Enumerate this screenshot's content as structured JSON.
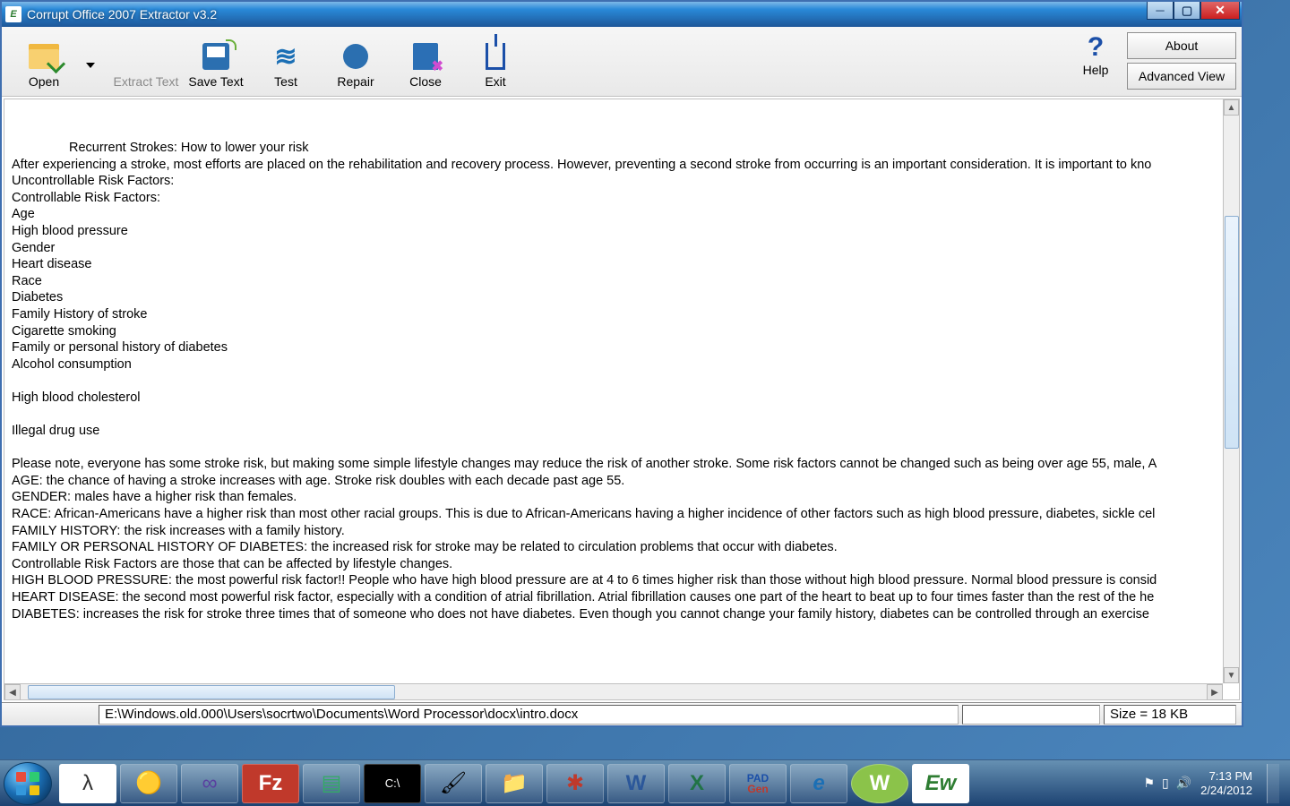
{
  "window": {
    "title": "Corrupt Office 2007 Extractor v3.2"
  },
  "toolbar": {
    "open": "Open",
    "extract_text": "Extract Text",
    "save_text": "Save Text",
    "test": "Test",
    "repair": "Repair",
    "close": "Close",
    "exit": "Exit",
    "help": "Help",
    "about": "About",
    "advanced_view": "Advanced View"
  },
  "document": {
    "lines": [
      "Recurrent Strokes: How to lower your risk",
      "After experiencing a stroke, most efforts are placed on the rehabilitation and recovery process. However, preventing a second stroke from occurring is an important consideration. It is important to kno",
      "Uncontrollable Risk Factors:",
      "Controllable Risk Factors:",
      "Age",
      "High blood pressure",
      "Gender",
      "Heart disease",
      "Race",
      "Diabetes",
      "Family History of stroke",
      "Cigarette smoking",
      "Family or personal history of diabetes",
      "Alcohol consumption",
      "",
      "High blood cholesterol",
      "",
      "Illegal drug use",
      "",
      "Please note, everyone has some stroke risk, but making some simple lifestyle changes may reduce the risk of another stroke. Some risk factors cannot be changed such as being over age 55, male, A",
      "AGE: the chance of having a stroke increases with age. Stroke risk doubles with each decade past age 55.",
      "GENDER: males have a higher risk than females.",
      "RACE: African-Americans have a higher risk than most other racial groups. This is due to African-Americans having a higher incidence of other factors such as high blood pressure, diabetes, sickle cel",
      "FAMILY HISTORY: the risk increases with a family history.",
      "FAMILY OR PERSONAL HISTORY OF DIABETES: the increased risk for stroke may be related to circulation problems that occur with diabetes.",
      "Controllable Risk Factors are those that can be affected by lifestyle changes.",
      "HIGH BLOOD PRESSURE: the most powerful risk factor!! People who have high blood pressure are at 4 to 6 times higher risk than those without high blood pressure. Normal blood pressure is consid",
      "HEART DISEASE: the second most powerful risk factor, especially with a condition of atrial fibrillation. Atrial fibrillation causes one part of the heart to beat up to four times faster than the rest of the he",
      "DIABETES: increases the risk for stroke three times that of someone who does not have diabetes. Even though you cannot change your family history, diabetes can be controlled through an exercise"
    ]
  },
  "status": {
    "path": "E:\\Windows.old.000\\Users\\socrtwo\\Documents\\Word Processor\\docx\\intro.docx",
    "size": "Size = 18 KB"
  },
  "taskbar": {
    "time": "7:13 PM",
    "date": "2/24/2012"
  }
}
